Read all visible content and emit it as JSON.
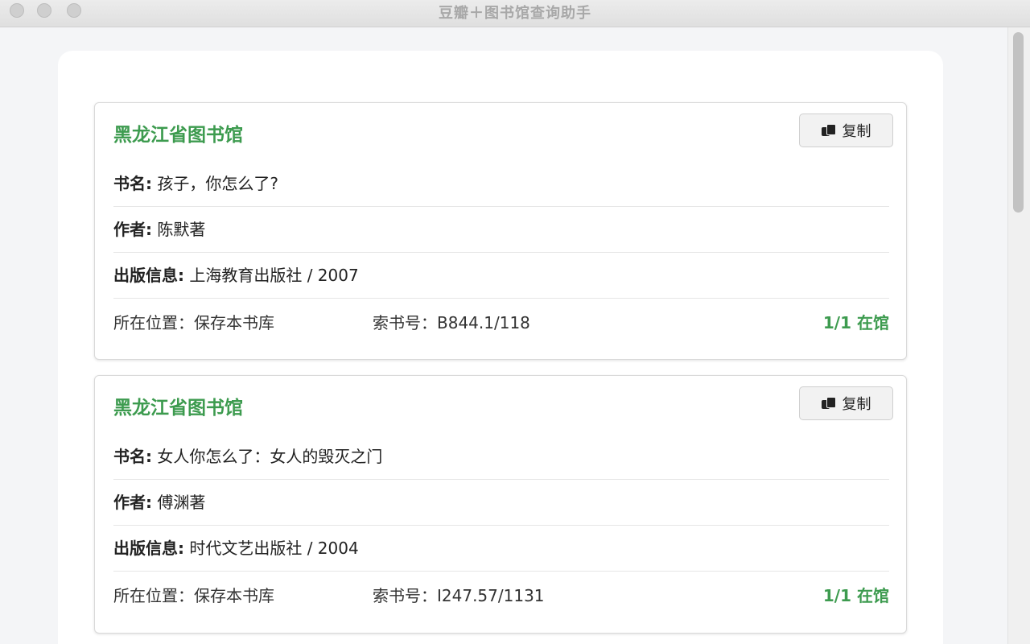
{
  "window": {
    "title": "豆瓣＋图书馆查询助手"
  },
  "colors": {
    "accent_green": "#3d9b4f",
    "background": "#f4f5f7"
  },
  "results": [
    {
      "library": "黑龙江省图书馆",
      "copy_label": "复制",
      "title_label": "书名:",
      "title": "孩子，你怎么了?",
      "author_label": "作者:",
      "author": "陈默著",
      "publication_label": "出版信息:",
      "publication": "上海教育出版社 / 2007",
      "location_label": "所在位置：",
      "location": "保存本书库",
      "callno_label": "索书号：",
      "callno": "B844.1/118",
      "status": "1/1 在馆"
    },
    {
      "library": "黑龙江省图书馆",
      "copy_label": "复制",
      "title_label": "书名:",
      "title": "女人你怎么了：女人的毁灭之门",
      "author_label": "作者:",
      "author": "傅渊著",
      "publication_label": "出版信息:",
      "publication": "时代文艺出版社 / 2004",
      "location_label": "所在位置：",
      "location": "保存本书库",
      "callno_label": "索书号：",
      "callno": "I247.57/1131",
      "status": "1/1 在馆"
    }
  ]
}
